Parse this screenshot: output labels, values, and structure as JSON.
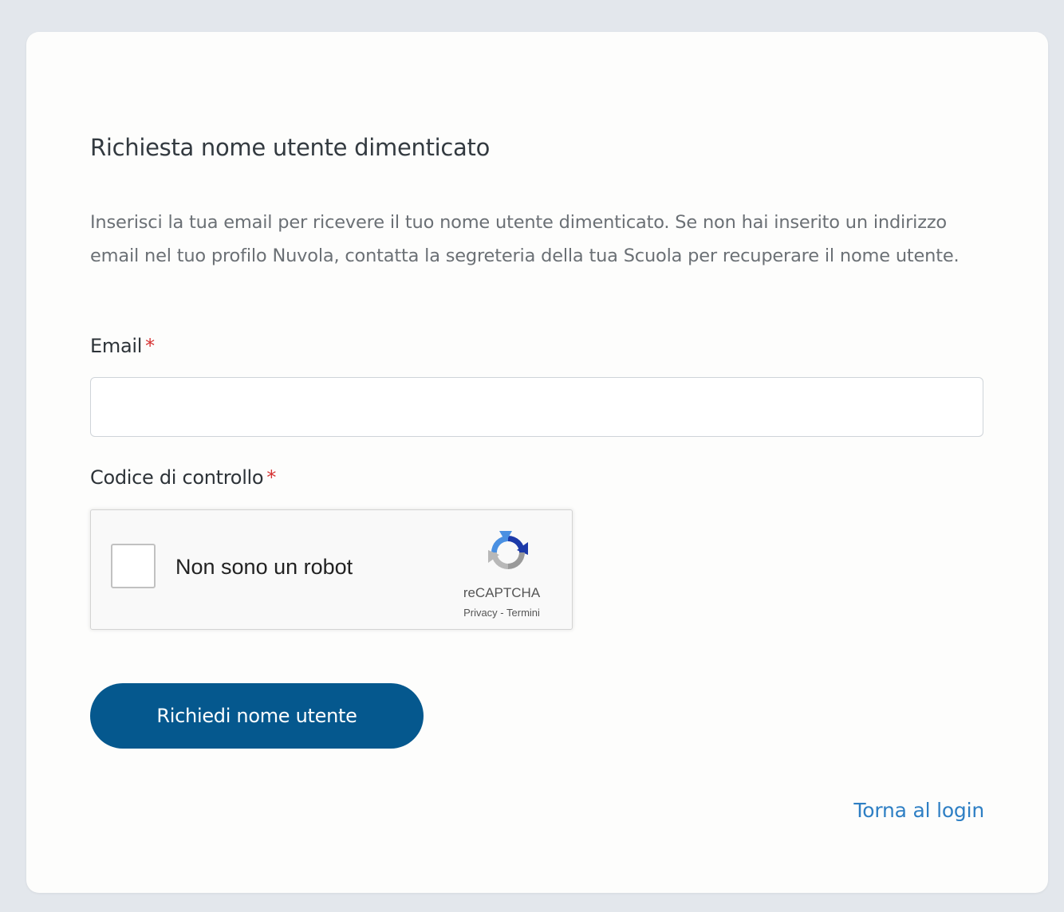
{
  "form": {
    "title": "Richiesta nome utente dimenticato",
    "description": "Inserisci la tua email per ricevere il tuo nome utente dimenticato. Se non hai inserito un indirizzo email nel tuo profilo Nuvola, contatta la segreteria della tua Scuola per recuperare il nome utente.",
    "email_label": "Email",
    "email_value": "",
    "email_placeholder": "",
    "code_label": "Codice di controllo",
    "required_marker": "*",
    "submit_label": "Richiedi nome utente",
    "back_link_label": "Torna al login"
  },
  "captcha": {
    "checkbox_label": "Non sono un robot",
    "checked": false,
    "brand": "reCAPTCHA",
    "privacy_label": "Privacy",
    "separator": " - ",
    "terms_label": "Termini",
    "icon": "recaptcha-logo-icon"
  },
  "colors": {
    "background": "#e3e7ec",
    "card": "#fdfdfc",
    "primary_button": "#05588e",
    "link": "#2e7fc4",
    "required": "#d63333"
  }
}
